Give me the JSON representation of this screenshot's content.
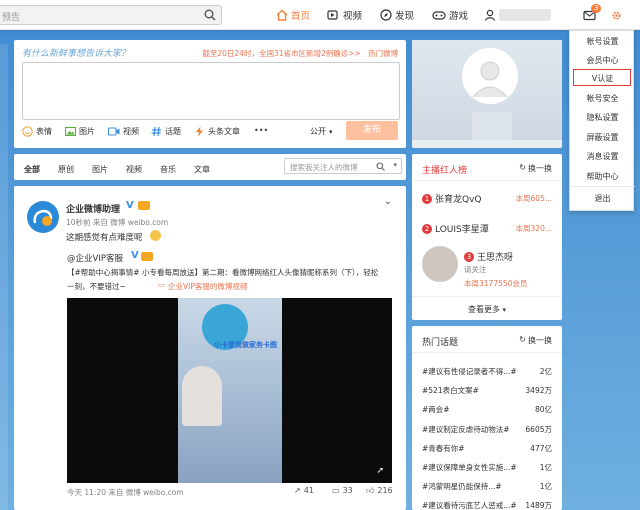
{
  "topbar": {
    "search_placeholder": "预告",
    "nav": {
      "home": "首页",
      "video": "视频",
      "discover": "发现",
      "game": "游戏"
    },
    "message_badge": "3"
  },
  "compose": {
    "hint": "有什么新鲜事想告诉大家？",
    "hot_text": "截至20日24时，全国31省市区新增2例确诊>>",
    "hot_link": "热门微博",
    "tools": [
      "表情",
      "图片",
      "视频",
      "话题",
      "头条文章",
      "•••"
    ],
    "visibility": "公开",
    "publish": "发布"
  },
  "feed_tabs": {
    "items": [
      "全部",
      "原创",
      "图片",
      "视频",
      "音乐",
      "文章"
    ],
    "search_placeholder": "搜索我关注人的微博"
  },
  "post": {
    "author": "企业微博助理",
    "meta": "10秒前 来自 微博 weibo.com",
    "text": "这期感觉有点难度呢",
    "repost_author": "@企业VIP客服",
    "repost_line1": "【#帮助中心揭事情# 小专看每周放送】第二期：看微博网络红人头像猜昵称系列（下），轻松",
    "repost_line2": "一刻，不要错过~",
    "video_link": "企业VIP客服的微博视频",
    "video_caption": "小卡爱我做家务卡图",
    "footer_time": "今天 11:20 来自 微博 weibo.com",
    "reposts": "41",
    "comments": "33",
    "likes": "216"
  },
  "rank": {
    "title": "主播红人榜",
    "refresh": "换一换",
    "items": [
      {
        "no": "1",
        "name": "张育龙QvQ",
        "count": "本周605..."
      },
      {
        "no": "2",
        "name": "LOUIS李星潭",
        "count": "本周320..."
      },
      {
        "no": "3",
        "name": "王思杰呀",
        "follow": "请关注",
        "count": "本周3177550会员"
      }
    ],
    "more": "查看更多"
  },
  "topics": {
    "title": "热门话题",
    "refresh": "换一换",
    "items": [
      {
        "t": "#建议有性侵记录者不得...#",
        "c": "2亿"
      },
      {
        "t": "#521表白文案#",
        "c": "3492万"
      },
      {
        "t": "#两会#",
        "c": "80亿"
      },
      {
        "t": "#建议制定反虐待动物法#",
        "c": "6605万"
      },
      {
        "t": "#青春有你#",
        "c": "477亿"
      },
      {
        "t": "#建议保障单身女性实施...#",
        "c": "1亿"
      },
      {
        "t": "#鸿蒙明星仍能保持...#",
        "c": "1亿"
      },
      {
        "t": "#建议看待污底艺人惩戒...#",
        "c": "1489万"
      }
    ]
  },
  "dropdown": {
    "items": [
      "帐号设置",
      "会员中心",
      "V认证",
      "帐号安全",
      "隐私设置",
      "屏蔽设置",
      "消息设置",
      "帮助中心",
      "退出"
    ]
  },
  "colors": {
    "accent": "#fa7d3c",
    "highlight": "#e43b3b",
    "link": "#eb7350"
  }
}
